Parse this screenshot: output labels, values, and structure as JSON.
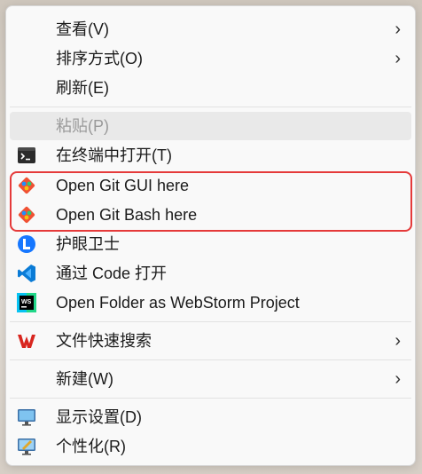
{
  "menu": {
    "items": {
      "view": {
        "label": "查看(V)",
        "chevron": "›",
        "icon": ""
      },
      "sort": {
        "label": "排序方式(O)",
        "chevron": "›",
        "icon": ""
      },
      "refresh": {
        "label": "刷新(E)",
        "icon": ""
      },
      "paste": {
        "label": "粘贴(P)",
        "icon": "",
        "disabled": true
      },
      "open_terminal": {
        "label": "在终端中打开(T)",
        "icon": "terminal-icon"
      },
      "git_gui": {
        "label": "Open Git GUI here",
        "icon": "git-icon"
      },
      "git_bash": {
        "label": "Open Git Bash here",
        "icon": "git-icon"
      },
      "eye_guard": {
        "label": "护眼卫士",
        "icon": "eye-guard-icon"
      },
      "open_code": {
        "label": "通过 Code 打开",
        "icon": "vscode-icon"
      },
      "webstorm": {
        "label": "Open Folder as WebStorm Project",
        "icon": "webstorm-icon"
      },
      "wps_search": {
        "label": "文件快速搜索",
        "chevron": "›",
        "icon": "wps-icon"
      },
      "new": {
        "label": "新建(W)",
        "chevron": "›",
        "icon": ""
      },
      "display": {
        "label": "显示设置(D)",
        "icon": "monitor-icon"
      },
      "personalize": {
        "label": "个性化(R)",
        "icon": "personalize-icon"
      }
    }
  },
  "colors": {
    "highlight_border": "#e53a3a",
    "git": "#f05133",
    "vscode": "#0a7bd6",
    "wps": "#d8261f"
  }
}
